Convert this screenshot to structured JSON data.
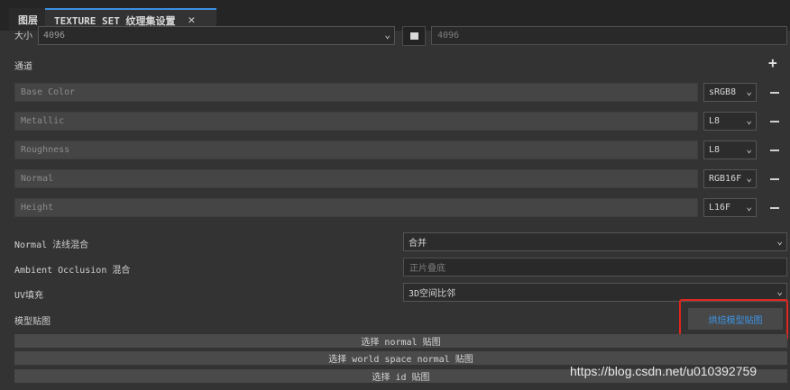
{
  "tabs": {
    "layers": "图层",
    "texture_set": "TEXTURE SET 纹理集设置",
    "close": "✕"
  },
  "size": {
    "label": "大小",
    "value": "4096",
    "value2": "4096"
  },
  "channels": {
    "title": "通道",
    "add": "+",
    "items": [
      {
        "name": "Base Color",
        "format": "sRGB8"
      },
      {
        "name": "Metallic",
        "format": "L8"
      },
      {
        "name": "Roughness",
        "format": "L8"
      },
      {
        "name": "Normal",
        "format": "RGB16F"
      },
      {
        "name": "Height",
        "format": "L16F"
      }
    ]
  },
  "blend": {
    "normal_label": "Normal 法线混合",
    "normal_value": "合并",
    "ao_label": "Ambient Occlusion 混合",
    "ao_value": "正片叠底",
    "uv_label": "UV填充",
    "uv_value": "3D空间比邻"
  },
  "mesh_maps": {
    "title": "模型贴图",
    "bake_button": "烘焙模型贴图",
    "select_normal": "选择 normal 贴图",
    "select_world_normal": "选择 world space normal 贴图",
    "select_id": "选择 id 贴图"
  },
  "watermark": "https://blog.csdn.net/u010392759",
  "colors": {
    "accent": "#3d8fe0",
    "highlight_frame": "#e0261e",
    "bake_text": "#3d95e6"
  }
}
